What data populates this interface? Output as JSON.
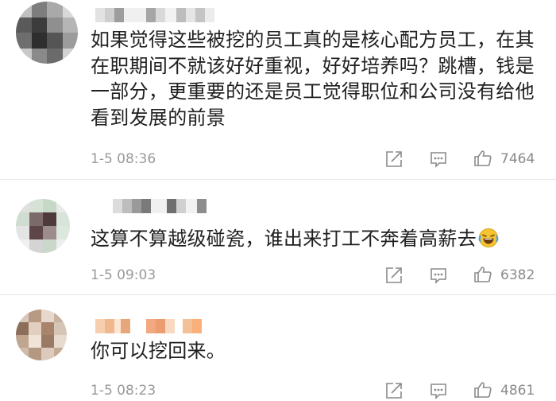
{
  "comments": [
    {
      "text": "如果觉得这些被挖的员工真的是核心配方员工，在其在职期间不就该好好重视，好好培养吗？跳槽，钱是一部分，更重要的还是员工觉得职位和公司没有给他看到发展的前景",
      "time": "1-5 08:36",
      "likes": "7464"
    },
    {
      "text": "这算不算越级碰瓷，谁出来打工不奔着高薪去",
      "emoji": "laughing-crying-emoji",
      "time": "1-5 09:03",
      "likes": "6382"
    },
    {
      "text": "你可以挖回来。",
      "time": "1-5 08:23",
      "likes": "4861"
    }
  ],
  "colors": {
    "text": "#1f1f1f",
    "meta": "#9a9a9a",
    "icon": "#8a8a8a",
    "divider": "#e6e6e6"
  },
  "icons": [
    "share-icon",
    "comment-icon",
    "like-icon"
  ]
}
